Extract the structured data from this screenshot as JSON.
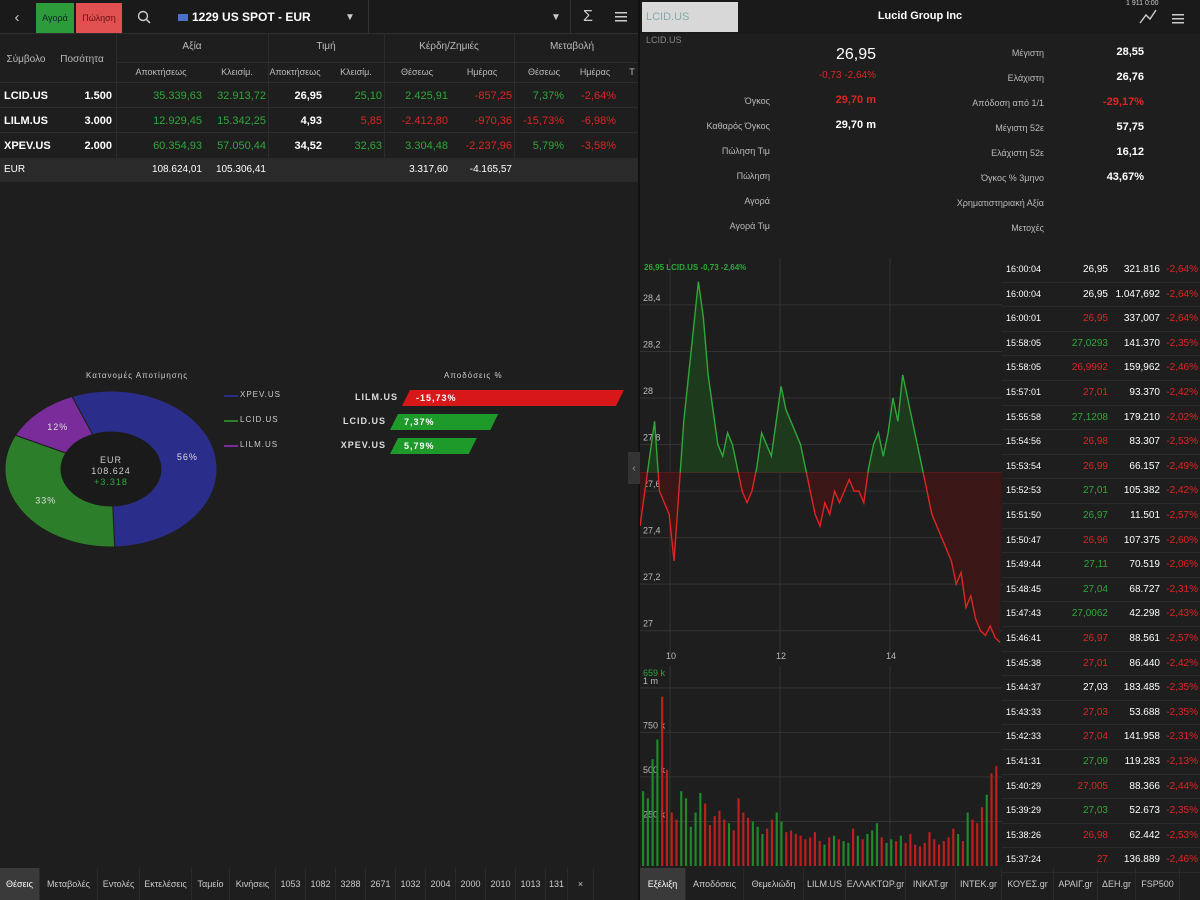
{
  "toolbar": {
    "back_icon": "chevron-left-icon",
    "buy": "Αγορά",
    "sell": "Πώληση",
    "search_icon": "search-icon",
    "account": "1229 US SPOT - EUR",
    "sum": "Σ",
    "menu_icon": "menu-icon"
  },
  "portfolio": {
    "headers": {
      "symbol": "Σύμβολο",
      "qty": "Ποσότητα",
      "value": "Αξία",
      "price": "Τιμή",
      "pnl": "Κέρδη/Ζημιές",
      "change": "Μεταβολή",
      "acq": "Αποκτήσεως",
      "close": "Κλεισίμ.",
      "acq2": "Αποκτήσεως",
      "close2": "Κλεισίμ.",
      "pos": "Θέσεως",
      "day": "Ημέρας",
      "pos2": "Θέσεως",
      "day2": "Ημέρας",
      "t": "Τ"
    },
    "rows": [
      {
        "symbol": "LCID.US",
        "qty": "1.500",
        "acq_val": "35.339,63",
        "close_val": "32.913,72",
        "acq_price": "26,95",
        "close_price": "25,10",
        "pnl_pos": "2.425,91",
        "pnl_day": "-857,25",
        "chg_pos": "7,37%",
        "chg_day": "-2,64%"
      },
      {
        "symbol": "LILM.US",
        "qty": "3.000",
        "acq_val": "12.929,45",
        "close_val": "15.342,25",
        "acq_price": "4,93",
        "close_price": "5,85",
        "pnl_pos": "-2.412,80",
        "pnl_day": "-970,36",
        "chg_pos": "-15,73%",
        "chg_day": "-6,98%"
      },
      {
        "symbol": "XPEV.US",
        "qty": "2.000",
        "acq_val": "60.354,93",
        "close_val": "57.050,44",
        "acq_price": "34,52",
        "close_price": "32,63",
        "pnl_pos": "3.304,48",
        "pnl_day": "-2.237,96",
        "chg_pos": "5,79%",
        "chg_day": "-3,58%"
      }
    ],
    "total": {
      "label": "EUR",
      "acq_val": "108.624,01",
      "close_val": "105.306,41",
      "pnl_pos": "3.317,60",
      "pnl_day": "-4.165,57"
    }
  },
  "donut": {
    "title": "Κατανομές Αποτίμησης",
    "center_ccy": "EUR",
    "center_val": "108.624",
    "center_pnl": "+3.318",
    "slices": [
      {
        "name": "XPEV.US",
        "pct": 56,
        "label": "56%",
        "color": "#2a2e8a"
      },
      {
        "name": "LCID.US",
        "pct": 33,
        "label": "33%",
        "color": "#2d7e2a"
      },
      {
        "name": "LILM.US",
        "pct": 12,
        "label": "12%",
        "color": "#7a2d9a"
      }
    ]
  },
  "returns": {
    "title": "Αποδόσεις %",
    "bars": [
      {
        "name": "LILM.US",
        "label": "-15,73%",
        "value": -15.73,
        "color": "#d81818"
      },
      {
        "name": "LCID.US",
        "label": "7,37%",
        "value": 7.37,
        "color": "#1e9a2a"
      },
      {
        "name": "XPEV.US",
        "label": "5,79%",
        "value": 5.79,
        "color": "#1e9a2a"
      }
    ]
  },
  "quote": {
    "symbol_box": "LCID.US",
    "title": "Lucid Group Inc",
    "status": "1 911 0:00",
    "sub_symbol": "LCID.US",
    "price": "26,95",
    "change": "-0,73 -2,64%",
    "left": [
      {
        "k": "Όγκος",
        "v": "29,70 m",
        "c": "red"
      },
      {
        "k": "Καθαρός Όγκος",
        "v": "29,70 m",
        "c": "white"
      },
      {
        "k": "Πώληση Τιμ",
        "v": "",
        "c": "white"
      },
      {
        "k": "Πώληση",
        "v": "",
        "c": "white"
      },
      {
        "k": "Αγορά",
        "v": "",
        "c": "white"
      },
      {
        "k": "Αγορά Τιμ",
        "v": "",
        "c": "white"
      }
    ],
    "right": [
      {
        "k": "Μέγιστη",
        "v": "28,55",
        "c": "white"
      },
      {
        "k": "Ελάχιστη",
        "v": "26,76",
        "c": "white"
      },
      {
        "k": "Απόδοση από 1/1",
        "v": "-29,17%",
        "c": "red"
      },
      {
        "k": "Μέγιστη 52ε",
        "v": "57,75",
        "c": "white"
      },
      {
        "k": "Ελάχιστη 52ε",
        "v": "16,12",
        "c": "white"
      },
      {
        "k": "Όγκος % 3μηνο",
        "v": "43,67%",
        "c": "white"
      },
      {
        "k": "Χρηματιστηριακή Αξία",
        "v": "",
        "c": "white"
      },
      {
        "k": "Μετοχές",
        "v": "",
        "c": "white"
      }
    ]
  },
  "chart_data": [
    {
      "type": "line",
      "title": "26,95 LCID.US -0,73 -2,64%",
      "x_ticks": [
        "10",
        "12",
        "14"
      ],
      "y_ticks": [
        "28,4",
        "28,2",
        "28",
        "27,8",
        "27,6",
        "27,4",
        "27,2",
        "27"
      ],
      "ylim": [
        26.9,
        28.55
      ],
      "baseline": 27.68,
      "values": [
        27.45,
        27.6,
        27.75,
        27.9,
        27.6,
        27.55,
        27.5,
        27.3,
        27.6,
        27.9,
        28.1,
        28.3,
        28.5,
        28.35,
        28.1,
        27.95,
        27.8,
        27.75,
        27.85,
        27.8,
        27.7,
        27.6,
        27.55,
        27.6,
        27.7,
        27.85,
        27.8,
        27.75,
        27.9,
        28.05,
        27.95,
        27.9,
        27.85,
        27.8,
        27.7,
        27.6,
        27.5,
        27.45,
        27.55,
        27.5,
        27.6,
        27.55,
        27.6,
        27.65,
        27.6,
        27.6,
        27.55,
        27.7,
        27.8,
        27.85,
        27.75,
        27.85,
        28.0,
        27.9,
        28.1,
        28.0,
        27.9,
        27.8,
        27.7,
        27.6,
        27.5,
        27.45,
        27.4,
        27.35,
        27.3,
        27.2,
        27.25,
        27.1,
        27.15,
        27.05,
        27.0,
        26.98,
        27.02,
        26.97,
        26.95
      ]
    },
    {
      "type": "bar",
      "title": "Volume",
      "y_ticks": [
        "659 k",
        "1 m",
        "750 k",
        "500 k",
        "250 k"
      ],
      "ylim": [
        0,
        1100
      ],
      "values": [
        420,
        380,
        600,
        710,
        950,
        540,
        300,
        260,
        420,
        380,
        220,
        300,
        410,
        350,
        230,
        280,
        310,
        260,
        240,
        200,
        380,
        300,
        270,
        250,
        220,
        180,
        210,
        260,
        300,
        250,
        190,
        200,
        180,
        170,
        150,
        160,
        190,
        140,
        120,
        160,
        170,
        150,
        140,
        130,
        210,
        170,
        150,
        180,
        200,
        240,
        160,
        130,
        150,
        140,
        170,
        130,
        180,
        120,
        110,
        130,
        190,
        150,
        120,
        140,
        160,
        210,
        180,
        140,
        300,
        260,
        240,
        330,
        400,
        520,
        560
      ]
    }
  ],
  "ticks": [
    {
      "t": "16:00:04",
      "p": "26,95",
      "v": "321.816",
      "c": "-2,64%",
      "pc": "white"
    },
    {
      "t": "16:00:04",
      "p": "26,95",
      "v": "1.047,692",
      "c": "-2,64%",
      "pc": "white"
    },
    {
      "t": "16:00:01",
      "p": "26,95",
      "v": "337,007",
      "c": "-2,64%",
      "pc": "red"
    },
    {
      "t": "15:58:05",
      "p": "27,0293",
      "v": "141.370",
      "c": "-2,35%",
      "pc": "green"
    },
    {
      "t": "15:58:05",
      "p": "26,9992",
      "v": "159,962",
      "c": "-2,46%",
      "pc": "red"
    },
    {
      "t": "15:57:01",
      "p": "27,01",
      "v": "93.370",
      "c": "-2,42%",
      "pc": "red"
    },
    {
      "t": "15:55:58",
      "p": "27,1208",
      "v": "179.210",
      "c": "-2,02%",
      "pc": "green"
    },
    {
      "t": "15:54:56",
      "p": "26,98",
      "v": "83.307",
      "c": "-2,53%",
      "pc": "red"
    },
    {
      "t": "15:53:54",
      "p": "26,99",
      "v": "66.157",
      "c": "-2,49%",
      "pc": "red"
    },
    {
      "t": "15:52:53",
      "p": "27,01",
      "v": "105.382",
      "c": "-2,42%",
      "pc": "green"
    },
    {
      "t": "15:51:50",
      "p": "26,97",
      "v": "11.501",
      "c": "-2,57%",
      "pc": "green"
    },
    {
      "t": "15:50:47",
      "p": "26,96",
      "v": "107.375",
      "c": "-2,60%",
      "pc": "red"
    },
    {
      "t": "15:49:44",
      "p": "27,11",
      "v": "70.519",
      "c": "-2,06%",
      "pc": "green"
    },
    {
      "t": "15:48:45",
      "p": "27,04",
      "v": "68.727",
      "c": "-2,31%",
      "pc": "green"
    },
    {
      "t": "15:47:43",
      "p": "27,0062",
      "v": "42.298",
      "c": "-2,43%",
      "pc": "green"
    },
    {
      "t": "15:46:41",
      "p": "26,97",
      "v": "88.561",
      "c": "-2,57%",
      "pc": "red"
    },
    {
      "t": "15:45:38",
      "p": "27,01",
      "v": "86.440",
      "c": "-2,42%",
      "pc": "red"
    },
    {
      "t": "15:44:37",
      "p": "27,03",
      "v": "183.485",
      "c": "-2,35%",
      "pc": "white"
    },
    {
      "t": "15:43:33",
      "p": "27,03",
      "v": "53.688",
      "c": "-2,35%",
      "pc": "red"
    },
    {
      "t": "15:42:33",
      "p": "27,04",
      "v": "141.958",
      "c": "-2,31%",
      "pc": "red"
    },
    {
      "t": "15:41:31",
      "p": "27,09",
      "v": "119.283",
      "c": "-2,13%",
      "pc": "green"
    },
    {
      "t": "15:40:29",
      "p": "27,005",
      "v": "88.366",
      "c": "-2,44%",
      "pc": "red"
    },
    {
      "t": "15:39:29",
      "p": "27,03",
      "v": "52.673",
      "c": "-2,35%",
      "pc": "green"
    },
    {
      "t": "15:38:26",
      "p": "26,98",
      "v": "62.442",
      "c": "-2,53%",
      "pc": "red"
    },
    {
      "t": "15:37:24",
      "p": "27",
      "v": "136.889",
      "c": "-2,46%",
      "pc": "red"
    }
  ],
  "bottom_left": [
    "Θέσεις",
    "Μεταβολές",
    "Εντολές",
    "Εκτελέσεις",
    "Ταμείο",
    "Κινήσεις",
    "1053",
    "1082",
    "3288",
    "2671",
    "1032",
    "2004",
    "2000",
    "2010",
    "1013",
    "131",
    "×"
  ],
  "bottom_right": [
    "Εξέλιξη",
    "Αποδόσεις",
    "Θεμελιώδη",
    "LILM.US",
    "ΕΛΛΑΚΤΩΡ.gr",
    "ΙΝΚΑΤ.gr",
    "ΙΝΤΕΚ.gr",
    "ΚΟΥΕΣ.gr",
    "ΑΡΑΙΓ.gr",
    "ΔΕΗ.gr",
    "FSP500"
  ]
}
